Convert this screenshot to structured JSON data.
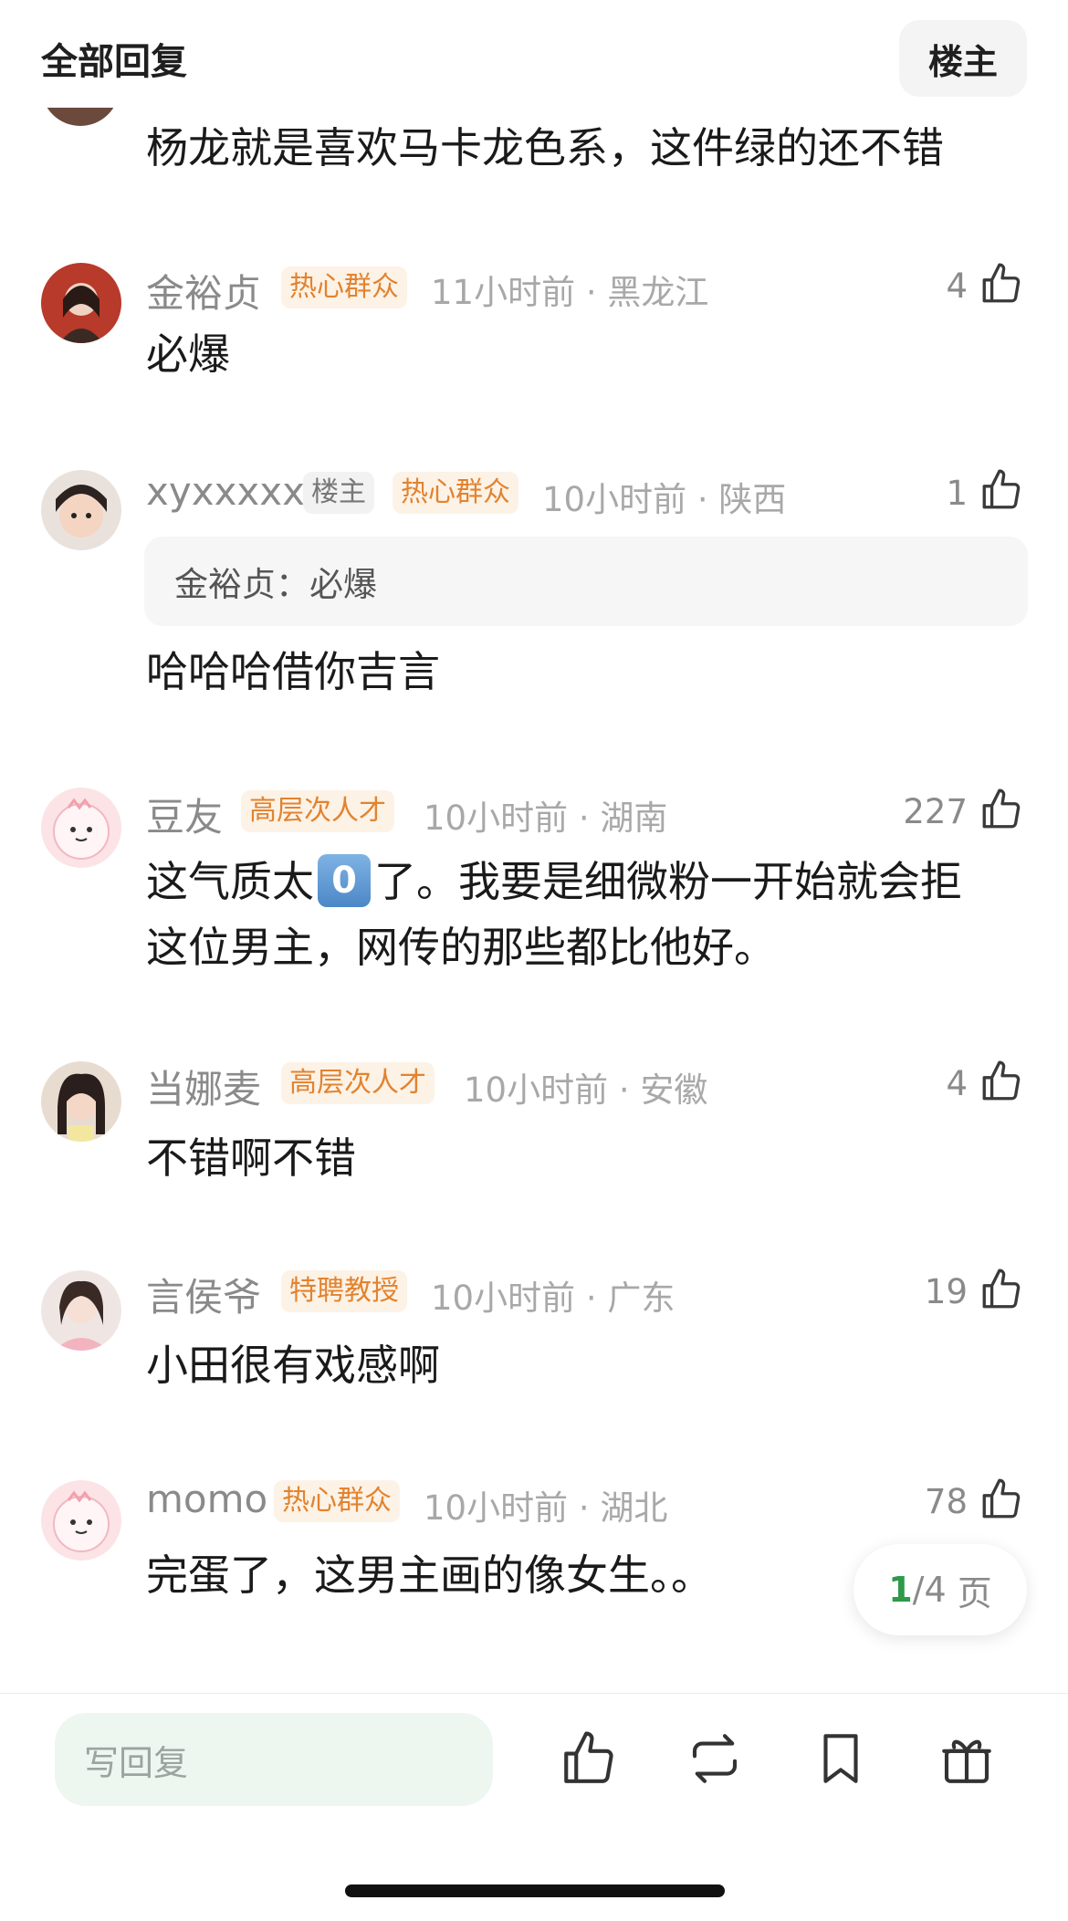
{
  "header": {
    "title": "全部回复",
    "op_button": "楼主"
  },
  "first_comment": {
    "text": "杨龙就是喜欢马卡龙色系，这件绿的还不错"
  },
  "comments": [
    {
      "username": "金裕贞",
      "badges": [
        "热心群众"
      ],
      "time": "11小时前",
      "location": "黑龙江",
      "likes": "4",
      "lines": [
        "必爆"
      ]
    },
    {
      "username": "xyxxxxx",
      "badges": [
        "楼主",
        "热心群众"
      ],
      "time": "10小时前",
      "location": "陕西",
      "likes": "1",
      "quote": "金裕贞：必爆",
      "lines": [
        "哈哈哈借你吉言"
      ]
    },
    {
      "username": "豆友",
      "badges": [
        "高层次人才"
      ],
      "time": "10小时前",
      "location": "湖南",
      "likes": "227",
      "lines": [
        "这气质太",
        "了。我要是细微粉一开始就会拒",
        "这位男主，网传的那些都比他好。"
      ],
      "emoji": "0"
    },
    {
      "username": "当娜麦",
      "badges": [
        "高层次人才"
      ],
      "time": "10小时前",
      "location": "安徽",
      "likes": "4",
      "lines": [
        "不错啊不错"
      ]
    },
    {
      "username": "言侯爷",
      "badges": [
        "特聘教授"
      ],
      "time": "10小时前",
      "location": "广东",
      "likes": "19",
      "lines": [
        "小田很有戏感啊"
      ]
    },
    {
      "username": "momo",
      "badges": [
        "热心群众"
      ],
      "time": "10小时前",
      "location": "湖北",
      "likes": "78",
      "lines": [
        "完蛋了，这男主画的像女生。。"
      ]
    }
  ],
  "pager": {
    "current": "1",
    "total": "/4",
    "suffix": "页"
  },
  "bottom_bar": {
    "reply_placeholder": "写回复",
    "icons": [
      "thumbs-up-icon",
      "repost-icon",
      "bookmark-icon",
      "gift-icon"
    ]
  },
  "colors": {
    "accent_green": "#2e9a4a",
    "badge_orange": "#e2832f",
    "badge_bg": "#fdf2e6",
    "input_bg": "#eef6f0"
  }
}
